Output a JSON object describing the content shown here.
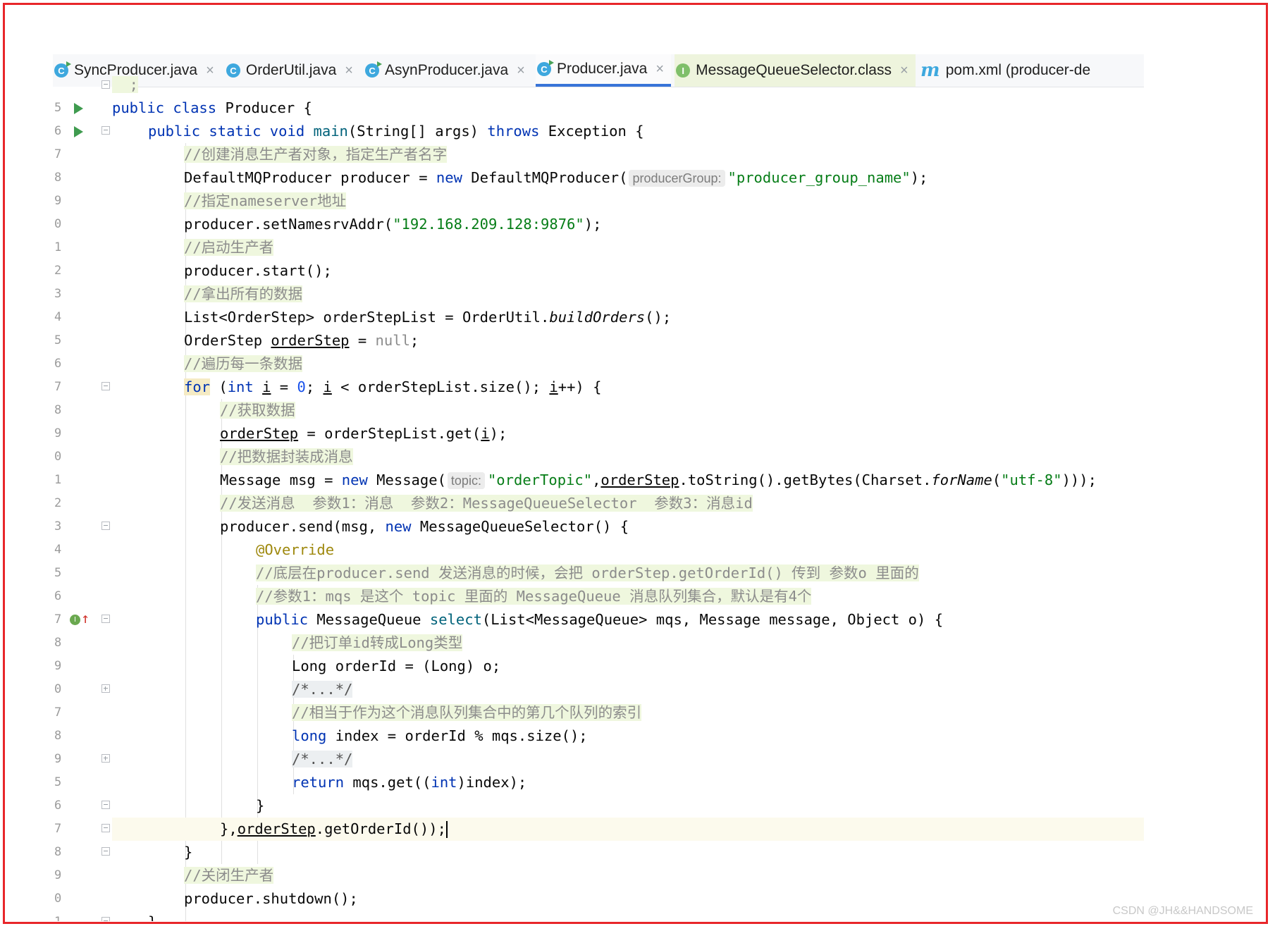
{
  "tabs": [
    {
      "label": "SyncProducer.java",
      "icon": "class-run-icon",
      "close": "×"
    },
    {
      "label": "OrderUtil.java",
      "icon": "class-icon",
      "close": "×"
    },
    {
      "label": "AsynProducer.java",
      "icon": "class-run-icon",
      "close": "×"
    },
    {
      "label": "Producer.java",
      "icon": "class-run-icon",
      "close": "×",
      "active": true
    },
    {
      "label": "MessageQueueSelector.class",
      "icon": "interface-icon",
      "close": "×"
    },
    {
      "label": "pom.xml (producer-de",
      "icon": "maven-icon"
    }
  ],
  "gutter_numbers": [
    "5",
    "6",
    "7",
    "8",
    "9",
    "0",
    "1",
    "2",
    "3",
    "4",
    "5",
    "6",
    "7",
    "8",
    "9",
    "0",
    "1",
    "2",
    "3",
    "4",
    "5",
    "6",
    "7",
    "8",
    "9",
    "0",
    "7",
    "8",
    "9",
    "5",
    "6",
    "7",
    "8",
    "9",
    "0",
    "1"
  ],
  "code": {
    "l1": {
      "kw1": "public class",
      "name": "Producer {"
    },
    "l2": {
      "kw": "public static void",
      "fn": "main",
      "p1": "(String[] args) ",
      "throws": "throws",
      "p2": " Exception {"
    },
    "l3": {
      "c": "//创建消息生产者对象，指定生产者名字"
    },
    "l4": {
      "a": "DefaultMQProducer producer = ",
      "new": "new",
      "b": " DefaultMQProducer(",
      "hint": "producerGroup:",
      "s": "\"producer_group_name\"",
      "e": ");"
    },
    "l5": {
      "c": "//指定nameserver地址"
    },
    "l6": {
      "a": "producer.setNamesrvAddr(",
      "s": "\"192.168.209.128:9876\"",
      "e": ");"
    },
    "l7": {
      "c": "//启动生产者"
    },
    "l8": {
      "a": "producer.start();"
    },
    "l9": {
      "c": "//拿出所有的数据"
    },
    "l10": {
      "a": "List<OrderStep> orderStepList = OrderUtil.",
      "it": "buildOrders",
      "e": "();"
    },
    "l11": {
      "a": "OrderStep ",
      "u": "orderStep",
      "b": " = ",
      "null": "null",
      "e": ";"
    },
    "l12": {
      "c": "//遍历每一条数据"
    },
    "l13": {
      "for": "for",
      "a": " (",
      "int": "int",
      "b": " ",
      "i1": "i",
      "c": " = ",
      "zero": "0",
      "d": "; ",
      "i2": "i",
      "e": " < orderStepList.size(); ",
      "i3": "i",
      "f": "++) {"
    },
    "l14": {
      "c": "//获取数据"
    },
    "l15": {
      "u": "orderStep",
      "a": " = orderStepList.get(",
      "i": "i",
      "e": ");"
    },
    "l16": {
      "c": "//把数据封装成消息"
    },
    "l17": {
      "a": "Message msg = ",
      "new": "new",
      "b": " Message(",
      "hint": "topic:",
      "s1": "\"orderTopic\"",
      "c": ",",
      "u": "orderStep",
      "d": ".toString().getBytes(Charset.",
      "it": "forName",
      "f": "(",
      "s2": "\"utf-8\"",
      "e": ")));"
    },
    "l18": {
      "c": "//发送消息  参数1：消息  参数2：MessageQueueSelector  参数3：消息id"
    },
    "l19": {
      "a": "producer.send(msg, ",
      "new": "new",
      "b": " MessageQueueSelector() {"
    },
    "l20": {
      "ann": "@Override"
    },
    "l21": {
      "c": "//底层在producer.send 发送消息的时候，会把 orderStep.getOrderId() 传到 参数o 里面的"
    },
    "l22": {
      "c": "//参数1：mqs 是这个 topic 里面的 MessageQueue 消息队列集合，默认是有4个"
    },
    "l23": {
      "kw": "public",
      "a": " MessageQueue ",
      "fn": "select",
      "b": "(List<MessageQueue> mqs, Message message, Object o) {"
    },
    "l24": {
      "c": "//把订单id转成Long类型"
    },
    "l25": {
      "a": "Long orderId = (Long) o;"
    },
    "l26": {
      "f": "/*...*/"
    },
    "l27": {
      "c": "//相当于作为这个消息队列集合中的第几个队列的索引"
    },
    "l28": {
      "long": "long",
      "a": " index = orderId % mqs.size();"
    },
    "l29": {
      "f": "/*...*/"
    },
    "l30": {
      "ret": "return",
      "a": " mqs.get((",
      "int": "int",
      "b": ")index);"
    },
    "l31": {
      "a": "}"
    },
    "l32": {
      "a": "},",
      "u": "orderStep",
      "b": ".getOrderId());"
    },
    "l33": {
      "a": "}"
    },
    "l34": {
      "c": "//关闭生产者"
    },
    "l35": {
      "a": "producer.shutdown();"
    },
    "l36": {
      "a": "}"
    }
  },
  "watermark": "CSDN @JH&&HANDSOME"
}
